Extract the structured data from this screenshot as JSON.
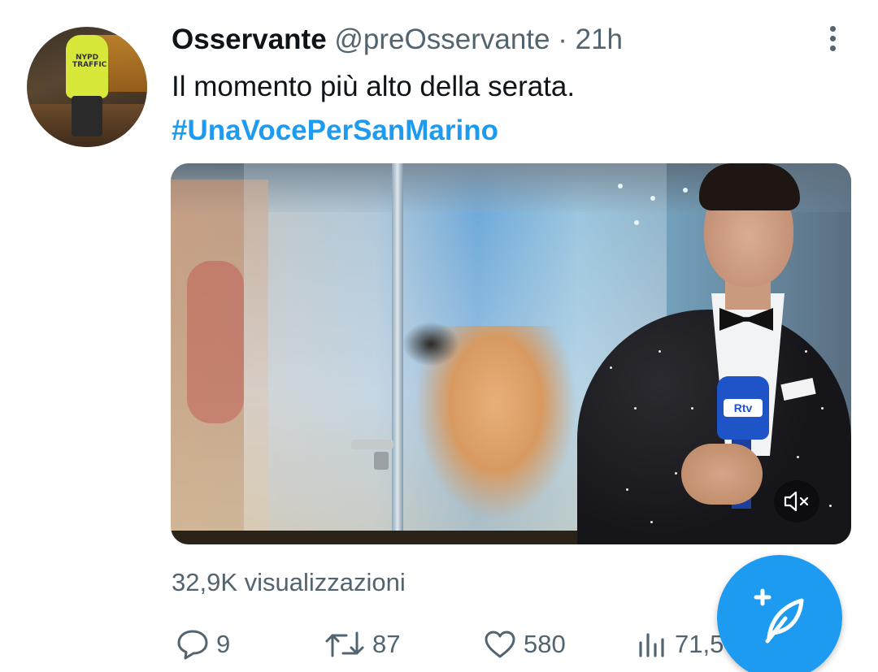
{
  "tweet": {
    "author_name": "Osservante",
    "handle": "@preOsservante",
    "separator": "·",
    "time": "21h",
    "text": "Il momento più alto della serata.",
    "hashtag": "#UnaVocePerSanMarino",
    "views": "32,9K visualizzazioni",
    "avatar_vest_text": "NYPD TRAFFIC",
    "media_mic_label": "Rtv"
  },
  "actions": {
    "replies": "9",
    "retweets": "87",
    "likes": "580",
    "views_count": "71,5"
  },
  "icons": {
    "more": "more-vertical-icon",
    "mute": "muted-speaker-icon",
    "reply": "reply-bubble-icon",
    "retweet": "retweet-icon",
    "like": "heart-icon",
    "analytics": "bar-chart-icon",
    "compose": "compose-feather-icon"
  },
  "colors": {
    "accent": "#1d9bf0",
    "text": "#0f1419",
    "secondary": "#536471"
  }
}
